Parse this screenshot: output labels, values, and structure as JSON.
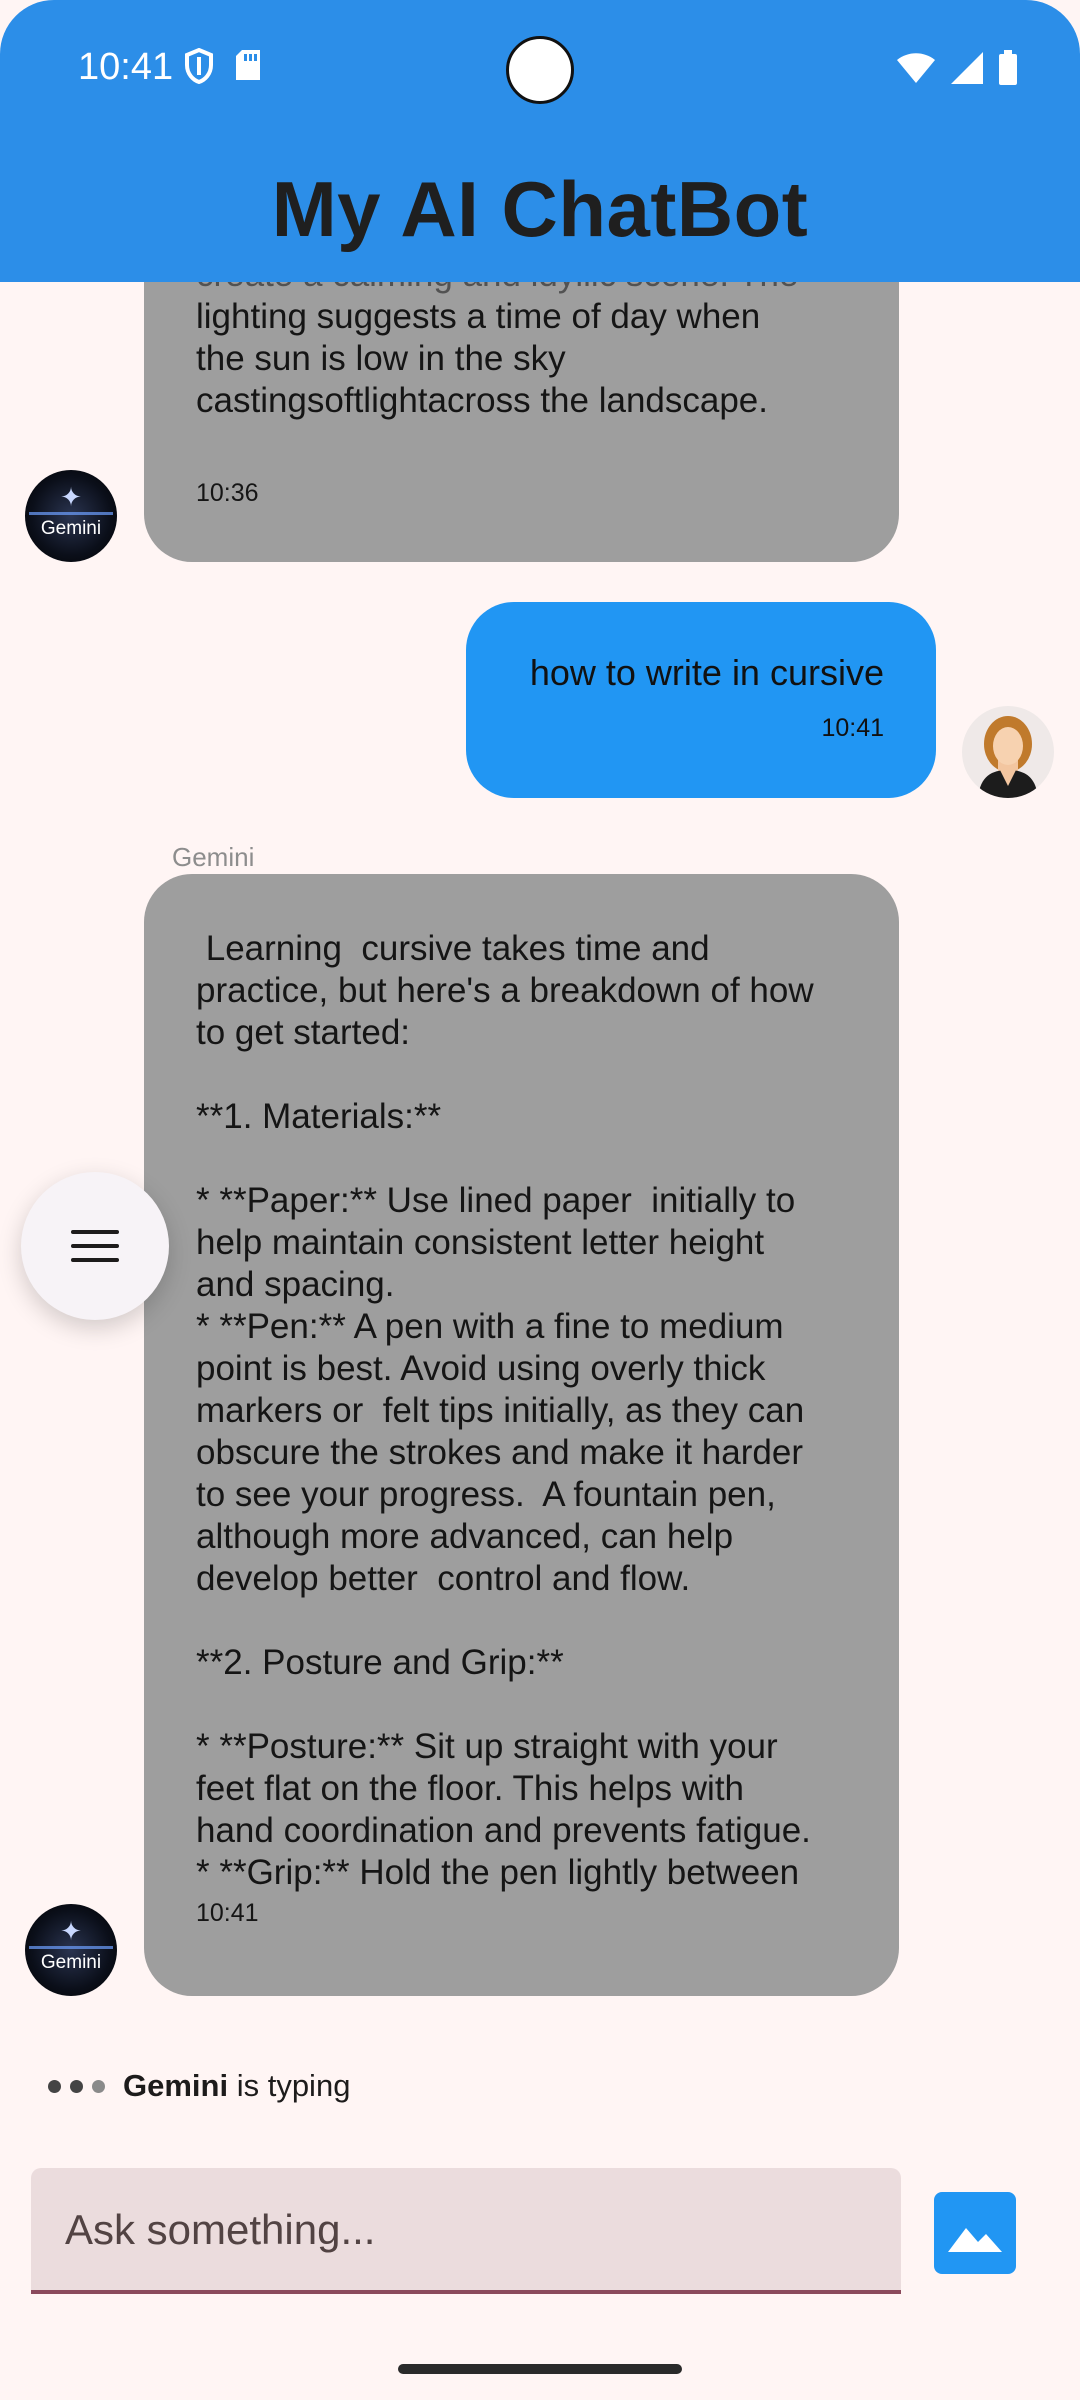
{
  "status_bar": {
    "time": "10:41"
  },
  "header": {
    "title": "My AI ChatBot"
  },
  "messages": [
    {
      "sender": "Gemini",
      "text_cutoff": "create a calming and idyllic scene. The",
      "text": "lighting suggests a time of day when\nthe sun is low in the sky\ncastingsoftlightacross the landscape.",
      "time": "10:36"
    },
    {
      "sender": "user",
      "text": "how to write in cursive",
      "time": "10:41"
    },
    {
      "sender": "Gemini",
      "name_label": "Gemini",
      "text": " Learning  cursive takes time and\npractice, but here's a breakdown of how\nto get started:\n\n**1. Materials:**\n\n* **Paper:** Use lined paper  initially to\nhelp maintain consistent letter height\nand spacing.\n* **Pen:** A pen with a fine to medium\npoint is best. Avoid using overly thick\nmarkers or  felt tips initially, as they can\nobscure the strokes and make it harder\nto see your progress.  A fountain pen,\nalthough more advanced, can help\ndevelop better  control and flow.\n\n**2. Posture and Grip:**\n\n* **Posture:** Sit up straight with your\nfeet flat on the floor. This helps with\nhand coordination and prevents fatigue.\n* **Grip:** Hold the pen lightly between",
      "time": "10:41"
    }
  ],
  "avatars": {
    "bot_label": "Gemini"
  },
  "typing": {
    "name": "Gemini",
    "suffix": " is typing"
  },
  "input": {
    "placeholder": "Ask something..."
  },
  "icons": {
    "fab": "menu-icon",
    "image_button": "image-icon",
    "status": [
      "shield-icon",
      "sd-card-icon",
      "wifi-icon",
      "signal-icon",
      "battery-icon"
    ]
  },
  "colors": {
    "appbar": "#2c8ee8",
    "bot_bubble": "#9e9e9e",
    "user_bubble": "#2196f3",
    "background": "#fff5f4",
    "input_fill": "#ebdcdd",
    "input_underline": "#8b4a5c"
  }
}
